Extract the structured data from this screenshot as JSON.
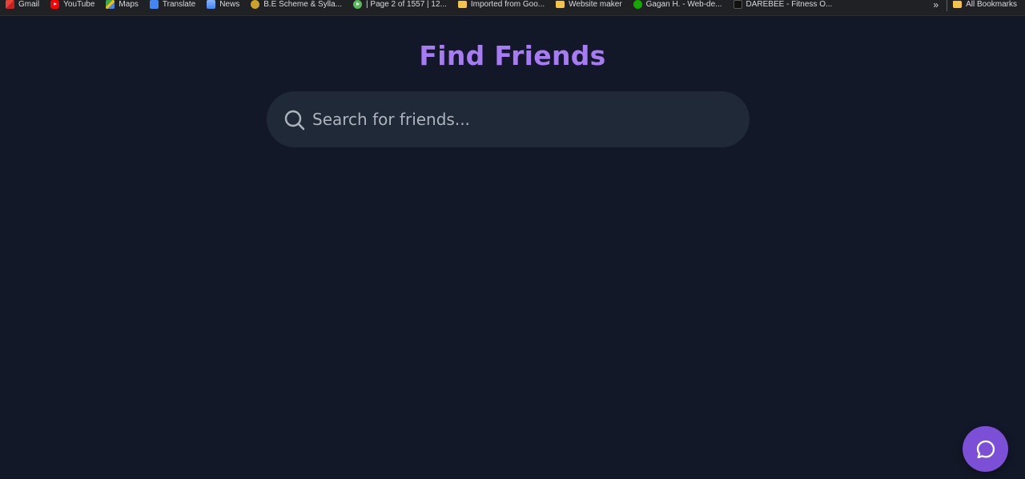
{
  "bookmarks": [
    {
      "label": "Gmail",
      "icon": "gmail-icon"
    },
    {
      "label": "YouTube",
      "icon": "youtube-icon"
    },
    {
      "label": "Maps",
      "icon": "maps-icon"
    },
    {
      "label": "Translate",
      "icon": "translate-icon"
    },
    {
      "label": "News",
      "icon": "news-icon"
    },
    {
      "label": "B.E Scheme & Sylla...",
      "icon": "emblem-icon"
    },
    {
      "label": "| Page 2 of 1557 | 12...",
      "icon": "play-icon"
    },
    {
      "label": "Imported from Goo...",
      "icon": "folder-icon"
    },
    {
      "label": "Website maker",
      "icon": "folder-icon"
    },
    {
      "label": "Gagan H. - Web-de...",
      "icon": "upwork-icon"
    },
    {
      "label": "DAREBEE - Fitness O...",
      "icon": "darebee-icon"
    }
  ],
  "bookmarks_more": "»",
  "bookmarks_all": "All Bookmarks",
  "page": {
    "title": "Find Friends",
    "search_placeholder": "Search for friends..."
  },
  "colors": {
    "background": "#121827",
    "accent": "#a77bf3",
    "search_bg": "#1f2937",
    "fab": "#7b4fd6"
  }
}
